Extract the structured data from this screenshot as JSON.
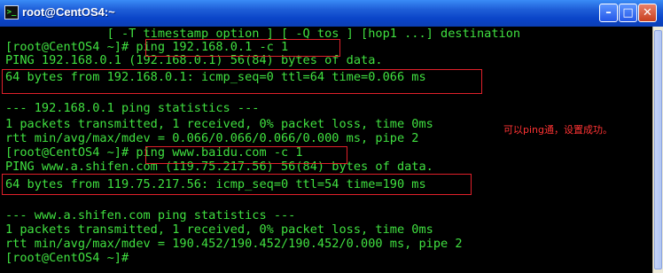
{
  "window": {
    "title": "root@CentOS4:~",
    "app_icon_glyph": ">_",
    "minimize_glyph": "–",
    "maximize_glyph": "□",
    "close_glyph": "✕"
  },
  "terminal": {
    "text_color": "#40e040",
    "lines": [
      "              [ -T timestamp option ] [ -Q tos ] [hop1 ...] destination",
      "[root@CentOS4 ~]# ping 192.168.0.1 -c 1",
      "PING 192.168.0.1 (192.168.0.1) 56(84) bytes of data.",
      "64 bytes from 192.168.0.1: icmp_seq=0 ttl=64 time=0.066 ms",
      "",
      "--- 192.168.0.1 ping statistics ---",
      "1 packets transmitted, 1 received, 0% packet loss, time 0ms",
      "rtt min/avg/max/mdev = 0.066/0.066/0.066/0.000 ms, pipe 2",
      "[root@CentOS4 ~]# ping www.baidu.com -c 1",
      "PING www.a.shifen.com (119.75.217.56) 56(84) bytes of data.",
      "64 bytes from 119.75.217.56: icmp_seq=0 ttl=54 time=190 ms",
      "",
      "--- www.a.shifen.com ping statistics ---",
      "1 packets transmitted, 1 received, 0% packet loss, time 0ms",
      "rtt min/avg/max/mdev = 190.452/190.452/190.452/0.000 ms, pipe 2",
      "[root@CentOS4 ~]#"
    ]
  },
  "annotation": {
    "text": "可以ping通，设置成功。",
    "color": "#ff3333"
  },
  "highlight_color": "#e0202a"
}
